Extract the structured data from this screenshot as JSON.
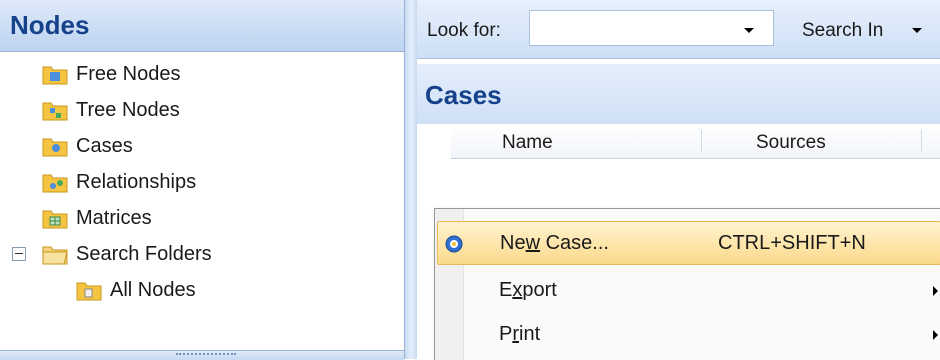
{
  "nodes_pane": {
    "title": "Nodes",
    "items": [
      {
        "label": "Free Nodes",
        "icon": "free-nodes-folder-icon"
      },
      {
        "label": "Tree Nodes",
        "icon": "tree-nodes-folder-icon"
      },
      {
        "label": "Cases",
        "icon": "cases-folder-icon"
      },
      {
        "label": "Relationships",
        "icon": "relationships-folder-icon"
      },
      {
        "label": "Matrices",
        "icon": "matrices-folder-icon"
      },
      {
        "label": "Search Folders",
        "icon": "search-folders-icon"
      },
      {
        "label": "All Nodes",
        "icon": "all-nodes-folder-icon"
      }
    ]
  },
  "find_bar": {
    "look_for_label": "Look for:",
    "look_for_value": "",
    "search_in_label": "Search In"
  },
  "list_view": {
    "title": "Cases",
    "columns": [
      "Name",
      "Sources"
    ]
  },
  "context_menu": {
    "items": [
      {
        "label_pre": "Ne",
        "label_accel": "w",
        "label_post": " Case...",
        "shortcut": "CTRL+SHIFT+N",
        "highlighted": true
      },
      {
        "label_pre": "E",
        "label_accel": "x",
        "label_post": "port",
        "shortcut": "",
        "submenu": true
      },
      {
        "label_pre": "P",
        "label_accel": "r",
        "label_post": "int",
        "shortcut": "",
        "submenu": true
      }
    ]
  },
  "colors": {
    "header_text": "#15428b",
    "menu_highlight": "#fbd98a",
    "folder_yellow": "#f5c542"
  }
}
